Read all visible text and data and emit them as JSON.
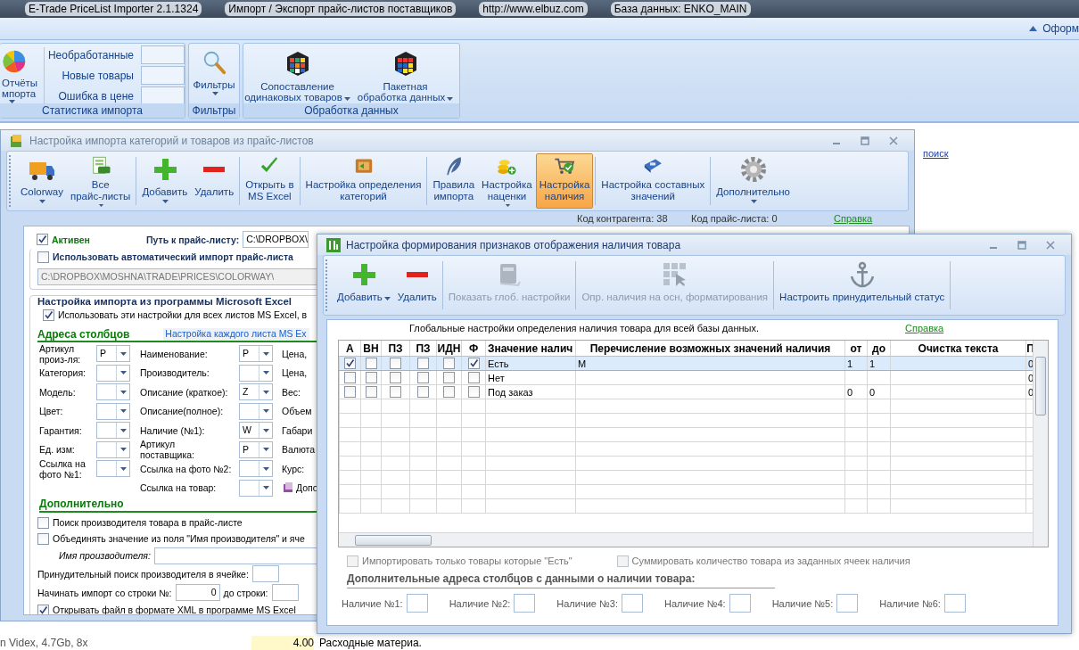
{
  "app_title": {
    "name": "E-Trade PriceList Importer 2.1.1324",
    "subtitle": "Импорт / Экспорт прайс-листов поставщиков",
    "url": "http://www.elbuz.com",
    "database": "База данных: ENKO_MAIN"
  },
  "ribbon_tab": "Оформ",
  "ribbon": {
    "stats_group": {
      "title": "Статистика импорта",
      "reports_button": {
        "label": "Отчёты\nмпорта",
        "dropdown": true
      },
      "counters": [
        {
          "label": "Необработанные"
        },
        {
          "label": "Новые товары"
        },
        {
          "label": "Ошибка в цене"
        }
      ]
    },
    "filters_group": {
      "title": "Фильтры",
      "button": {
        "label": "Фильтры",
        "dropdown": true
      }
    },
    "processing_group": {
      "title": "Обработка данных",
      "buttons": [
        {
          "label": "Сопоставление\nодинаковых товаров",
          "dropdown": true
        },
        {
          "label": "Пакетная\nобработка данных",
          "dropdown": true
        }
      ]
    }
  },
  "background": {
    "search_link": "поиск",
    "bottom_row": {
      "column_1": "n Videx, 4.7Gb, 8x",
      "column_2": "4.00",
      "column_3": "Расходные материа."
    }
  },
  "left_dialog": {
    "title": "Настройка импорта категорий и товаров из прайс-листов",
    "toolbar": [
      {
        "label": "Colorway\n",
        "dropdown": true,
        "selected": false
      },
      {
        "label": "Все\nпрайс-листы",
        "dropdown": true,
        "selected": false
      },
      {
        "label": "Добавить",
        "dropdown": true,
        "selected": false
      },
      {
        "label": "Удалить",
        "dropdown": false,
        "selected": false
      },
      {
        "label": "Открыть в\nMS Excel",
        "dropdown": false,
        "selected": false
      },
      {
        "label": "Настройка определения\nкатегорий",
        "dropdown": false,
        "selected": false
      },
      {
        "label": "Правила\nимпорта",
        "dropdown": false,
        "selected": false
      },
      {
        "label": "Настройка\nнаценки",
        "dropdown": true,
        "selected": false
      },
      {
        "label": "Настройка\nналичия",
        "dropdown": false,
        "selected": true
      },
      {
        "label": "Настройка составных\nзначений",
        "dropdown": false,
        "selected": false
      },
      {
        "label": "Дополнительно",
        "dropdown": true,
        "selected": false
      }
    ],
    "info": [
      "Код контрагента: 38",
      "Код прайс-листа: 0"
    ],
    "help_link": "Справка",
    "form": {
      "active": {
        "label": "Активен",
        "checked": true
      },
      "path_label": "Путь к прайс-листу:",
      "path_value": "C:\\DROPBOX\\",
      "auto_import": {
        "label": "Использовать автоматический импорт прайс-листа",
        "checked": false
      },
      "auto_path": "C:\\DROPBOX\\MOSHNA\\TRADE\\PRICES\\COLORWAY\\",
      "excel_title": "Настройка импорта из программы Microsoft Excel",
      "all_sheets": {
        "label": "Использовать эти настройки для всех листов MS Excel, в",
        "checked": true
      },
      "each_sheet_link": "Настройка каждого листа MS Ex",
      "columns_title": "Адреса столбцов",
      "address_rows": [
        [
          {
            "label": "Артикул\nпроиз-ля:",
            "value": "P"
          },
          {
            "label": "Наименование:",
            "value": "P"
          },
          {
            "label": "Цена,"
          }
        ],
        [
          {
            "label": "Категория:"
          },
          {
            "label": "Производитель:"
          },
          {
            "label": "Цена,"
          }
        ],
        [
          {
            "label": "Модель:"
          },
          {
            "label": "Описание (краткое):",
            "value": "Z"
          },
          {
            "label": "Вес:"
          }
        ],
        [
          {
            "label": "Цвет:"
          },
          {
            "label": "Описание(полное):"
          },
          {
            "label": "Объем"
          }
        ],
        [
          {
            "label": "Гарантия:"
          },
          {
            "label": "Наличие (№1):",
            "value": "W"
          },
          {
            "label": "Габари"
          }
        ],
        [
          {
            "label": "Ед. изм:"
          },
          {
            "label": "Артикул\nпоставщика:",
            "value": "P"
          },
          {
            "label": "Валюта"
          }
        ],
        [
          {
            "label": "Ссылка на\nфото №1:"
          },
          {
            "label": "Ссылка на фото №2:"
          },
          {
            "label": "Курс:"
          }
        ],
        [
          null,
          {
            "label": "Ссылка на товар:"
          },
          {
            "label": "Допо"
          }
        ]
      ],
      "extra_title": "Дополнительно",
      "search_manufacturer": {
        "label": "Поиск производителя товара в прайс-листе",
        "checked": false
      },
      "merge": {
        "label": "Объединять значение из поля \"Имя производителя\" и яче",
        "checked": false
      },
      "manufacturer_name_label": "Имя производителя:",
      "forced_search_label": "Принудительный поиск производителя в ячейке:",
      "start_row_label": "Начинать импорт со строки №:",
      "start_row_value": "0",
      "end_row_label": "до строки:",
      "open_xml": {
        "label": "Открывать файл в формате XML в программе MS Excel",
        "checked": true
      }
    }
  },
  "right_dialog": {
    "title": "Настройка формирования признаков отображения наличия товара",
    "toolbar": [
      {
        "label": "Добавить",
        "dropdown": true,
        "disabled": false
      },
      {
        "label": "Удалить",
        "dropdown": false,
        "disabled": false
      },
      {
        "label": "Показать глоб. настройки",
        "dropdown": false,
        "disabled": true
      },
      {
        "label": "Опр. наличия на осн, форматирования",
        "dropdown": false,
        "disabled": true
      },
      {
        "label": "Настроить принудительный статус",
        "dropdown": false,
        "disabled": false
      }
    ],
    "global_note": "Глобальные настройки определения наличия товара для всей базы данных.",
    "help_link": "Справка",
    "table": {
      "columns": [
        "А",
        "ВН",
        "ПЗ",
        "ПЗ",
        "ИДН",
        "Ф",
        "Значение налич",
        "Перечисление возможных значений наличия",
        "от",
        "до",
        "Очистка текста",
        "П"
      ],
      "rows": [
        {
          "flags": [
            true,
            false,
            false,
            false,
            false,
            true
          ],
          "value": "Есть",
          "values_list": "M",
          "from": "1",
          "to": "1",
          "column_12": "0",
          "selected": true
        },
        {
          "flags": [
            false,
            false,
            false,
            false,
            false,
            false
          ],
          "value": "Нет",
          "column_12": "0",
          "selected": false
        },
        {
          "flags": [
            false,
            false,
            false,
            false,
            false,
            false
          ],
          "value": "Под заказ",
          "from": "0",
          "to": "0",
          "column_12": "0",
          "selected": false
        }
      ]
    },
    "import_only_yes": {
      "label": "Импортировать только товары которые \"Есть\"",
      "checked": false,
      "disabled": true
    },
    "sum_quantity": {
      "label": "Суммировать количество товара из заданных ячеек наличия",
      "checked": false,
      "disabled": true
    },
    "extra_title": "Дополнительные адреса столбцов с данными о наличии товара:",
    "availability_fields": [
      {
        "label": "Наличие №1:"
      },
      {
        "label": "Наличие №2:"
      },
      {
        "label": "Наличие №3:"
      },
      {
        "label": "Наличие №4:"
      },
      {
        "label": "Наличие №5:"
      },
      {
        "label": "Наличие №6:"
      }
    ]
  }
}
